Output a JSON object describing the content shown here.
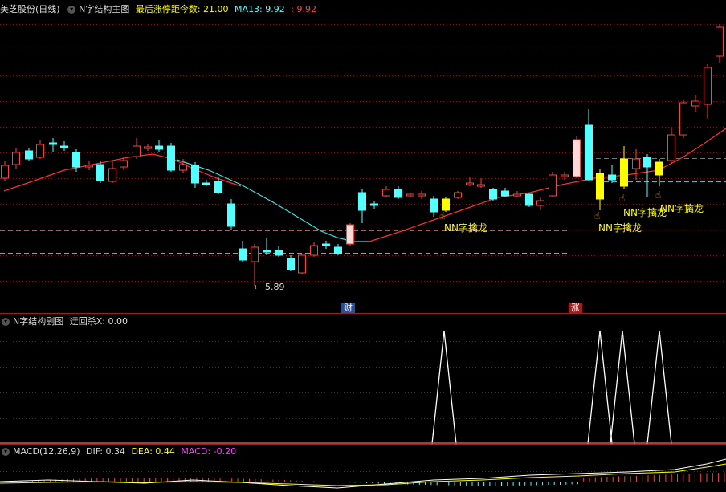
{
  "main_header": {
    "stock": "美芝股份(日线)",
    "indicator": "N字结构主图",
    "stat_label": "最后涨停距今数:",
    "stat_value": "21.00",
    "ma_label": "MA13:",
    "ma_value": "9.92",
    "sep": ":",
    "ma_value2": "9.92"
  },
  "sub_header": {
    "indicator": "N字结构副图",
    "label": "迂回杀X:",
    "value": "0.00"
  },
  "macd_header": {
    "name": "MACD(12,26,9)",
    "dif_label": "DIF:",
    "dif_value": "0.34",
    "dea_label": "DEA:",
    "dea_value": "0.44",
    "macd_label": "MACD:",
    "macd_value": "-0.20"
  },
  "annotations": {
    "low_price": "5.89",
    "signal_label": "NN字擒龙",
    "marker_cai": "财",
    "marker_zhang": "涨"
  },
  "colors": {
    "up": "#ff4040",
    "down": "#54ffff",
    "ma": "#ff3030",
    "ma_cyan": "#40e0e0",
    "signal": "#ffff00",
    "magenta_line": "#c040c0",
    "cyan_line": "#40c0c0",
    "grid": "#8b1a1a",
    "header_yellow": "#ffff00",
    "header_cyan": "#54ffff",
    "header_red": "#ff4040",
    "macd_magenta": "#ff40ff"
  }
}
